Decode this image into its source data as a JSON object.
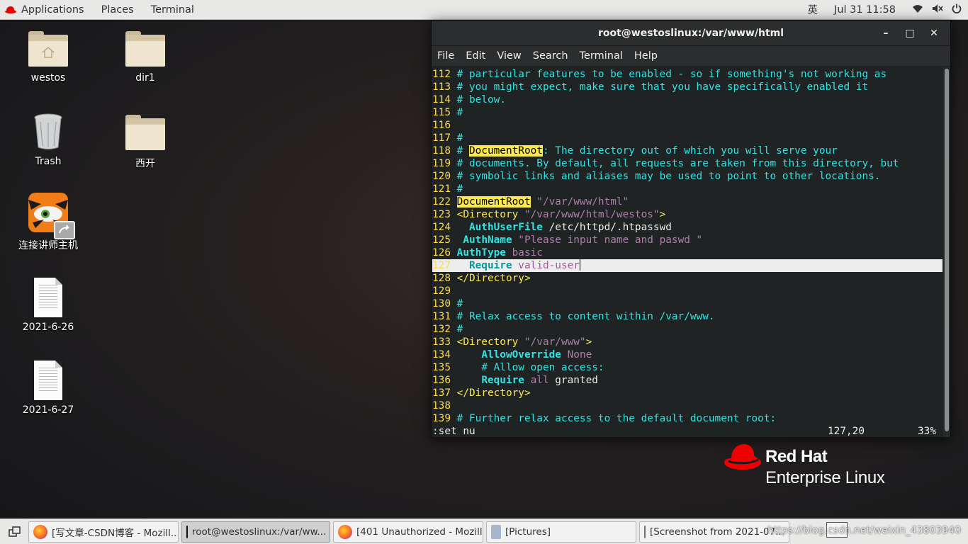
{
  "topbar": {
    "applications": "Applications",
    "places": "Places",
    "terminal": "Terminal",
    "input_method": "英",
    "clock": "Jul 31  11:58"
  },
  "desktop": {
    "icons": [
      {
        "label": "westos",
        "type": "home-folder"
      },
      {
        "label": "dir1",
        "type": "folder"
      },
      {
        "label": "Trash",
        "type": "trash"
      },
      {
        "label": "西开",
        "type": "folder"
      },
      {
        "label": "连接讲师主机",
        "type": "app"
      },
      {
        "label": "2021-6-26",
        "type": "document"
      },
      {
        "label": "2021-6-27",
        "type": "document"
      }
    ]
  },
  "terminal": {
    "title": "root@westoslinux:/var/www/html",
    "menu": [
      "File",
      "Edit",
      "View",
      "Search",
      "Terminal",
      "Help"
    ],
    "lines": [
      {
        "n": "112",
        "text": "# particular features to be enabled - so if something's not working as"
      },
      {
        "n": "113",
        "text": "# you might expect, make sure that you have specifically enabled it"
      },
      {
        "n": "114",
        "text": "# below."
      },
      {
        "n": "115",
        "text": "#"
      },
      {
        "n": "116",
        "text": ""
      },
      {
        "n": "117",
        "text": "#"
      },
      {
        "n": "118",
        "pre": "# ",
        "hl": "DocumentRoot",
        "text": ": The directory out of which you will serve your"
      },
      {
        "n": "119",
        "text": "# documents. By default, all requests are taken from this directory, but"
      },
      {
        "n": "120",
        "text": "# symbolic links and aliases may be used to point to other locations."
      },
      {
        "n": "121",
        "text": "#"
      },
      {
        "n": "122",
        "hl": "DocumentRoot",
        "value": " \"/var/www/html\""
      },
      {
        "n": "123",
        "tag": "<Directory",
        "value": " \"/var/www/html/westos\"",
        "tag_end": ">"
      },
      {
        "n": "124",
        "indent": "  ",
        "kw": "AuthUserFile",
        "plain": " /etc/httpd/.htpasswd"
      },
      {
        "n": "125",
        "indent": " ",
        "kw": "AuthName",
        "value": " \"Please input name and paswd \""
      },
      {
        "n": "126",
        "kw": "AuthType",
        "value": " basic"
      },
      {
        "n": "127",
        "indent": "  ",
        "kw": "Require",
        "value": " valid-user",
        "current": true
      },
      {
        "n": "128",
        "tag": "</Directory>"
      },
      {
        "n": "129",
        "text": ""
      },
      {
        "n": "130",
        "text": "#"
      },
      {
        "n": "131",
        "text": "# Relax access to content within /var/www."
      },
      {
        "n": "132",
        "text": "#"
      },
      {
        "n": "133",
        "tag": "<Directory",
        "value": " \"/var/www\"",
        "tag_end": ">"
      },
      {
        "n": "134",
        "indent": "    ",
        "kw": "AllowOverride",
        "value": " None"
      },
      {
        "n": "135",
        "indent": "    ",
        "text": "# Allow open access:"
      },
      {
        "n": "136",
        "indent": "    ",
        "kw": "Require",
        "value": " all",
        "plain": " granted"
      },
      {
        "n": "137",
        "tag": "</Directory>"
      },
      {
        "n": "138",
        "text": ""
      },
      {
        "n": "139",
        "text": "# Further relax access to the default document root:"
      }
    ],
    "command": ":set nu",
    "cursor_pos": "127,20",
    "scroll_pct": "33%"
  },
  "branding": {
    "line1": "Red Hat",
    "line2": "Enterprise Linux"
  },
  "taskbar": {
    "tasks": [
      {
        "label": "[写文章-CSDN博客 - Mozill...",
        "icon": "firefox-icon",
        "active": false
      },
      {
        "label": "root@westoslinux:/var/ww...",
        "icon": "terminal-icon",
        "active": true
      },
      {
        "label": "[401 Unauthorized - Mozill...",
        "icon": "firefox-icon",
        "active": false
      },
      {
        "label": "[Pictures]",
        "icon": "file-manager-icon",
        "active": false
      },
      {
        "label": "[Screenshot from 2021-07...",
        "icon": "screenshot-icon",
        "active": false
      }
    ],
    "watermark": "https://blog.csdn.net/weixin_43803940"
  }
}
